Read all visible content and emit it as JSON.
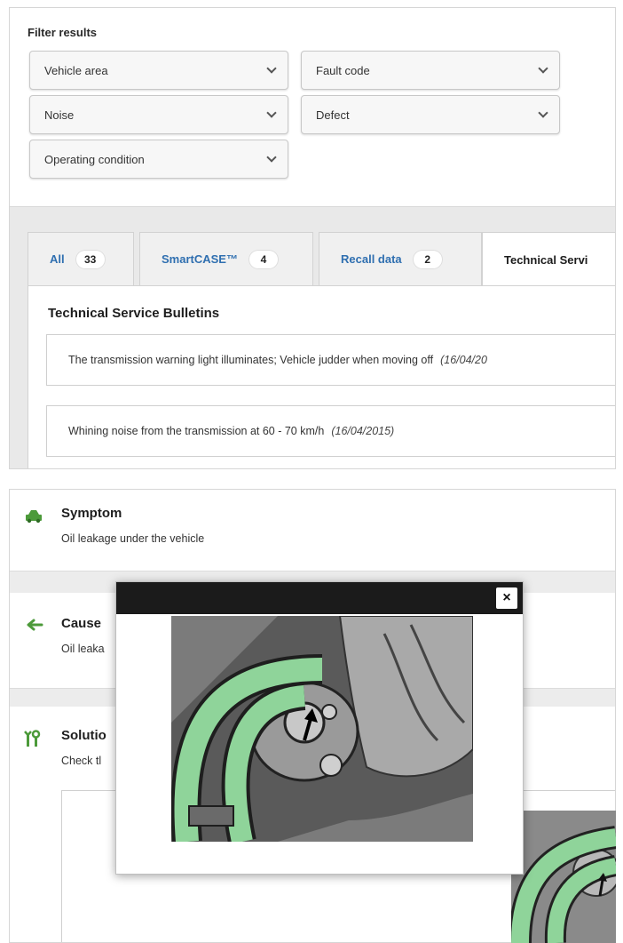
{
  "filter": {
    "title": "Filter results",
    "dropdowns": [
      {
        "label": "Vehicle area"
      },
      {
        "label": "Fault code"
      },
      {
        "label": "Noise"
      },
      {
        "label": "Defect"
      },
      {
        "label": "Operating condition"
      }
    ]
  },
  "tabs": [
    {
      "label": "All",
      "count": "33"
    },
    {
      "label": "SmartCASE™",
      "count": "4"
    },
    {
      "label": "Recall data",
      "count": "2"
    },
    {
      "label": "Technical Servi",
      "count": ""
    }
  ],
  "bulletins": {
    "title": "Technical Service Bulletins",
    "items": [
      {
        "text": "The transmission warning light illuminates; Vehicle judder when moving off",
        "date": "(16/04/20"
      },
      {
        "text": "Whining noise from the transmission at 60 - 70 km/h",
        "date": "(16/04/2015)"
      }
    ]
  },
  "detail": {
    "symptom": {
      "title": "Symptom",
      "text": "Oil leakage under the vehicle",
      "icon": "car-icon"
    },
    "cause": {
      "title": "Cause",
      "text": "Oil leaka",
      "icon": "arrow-icon"
    },
    "solution": {
      "title": "Solutio",
      "text": "Check tl",
      "icon": "tools-icon"
    }
  },
  "modal": {
    "close_label": "×"
  },
  "colors": {
    "link": "#2f6fb0",
    "icon_green": "#4c9a3a",
    "hose_green": "#8fd49a",
    "modal_bar": "#1b1b1b"
  }
}
